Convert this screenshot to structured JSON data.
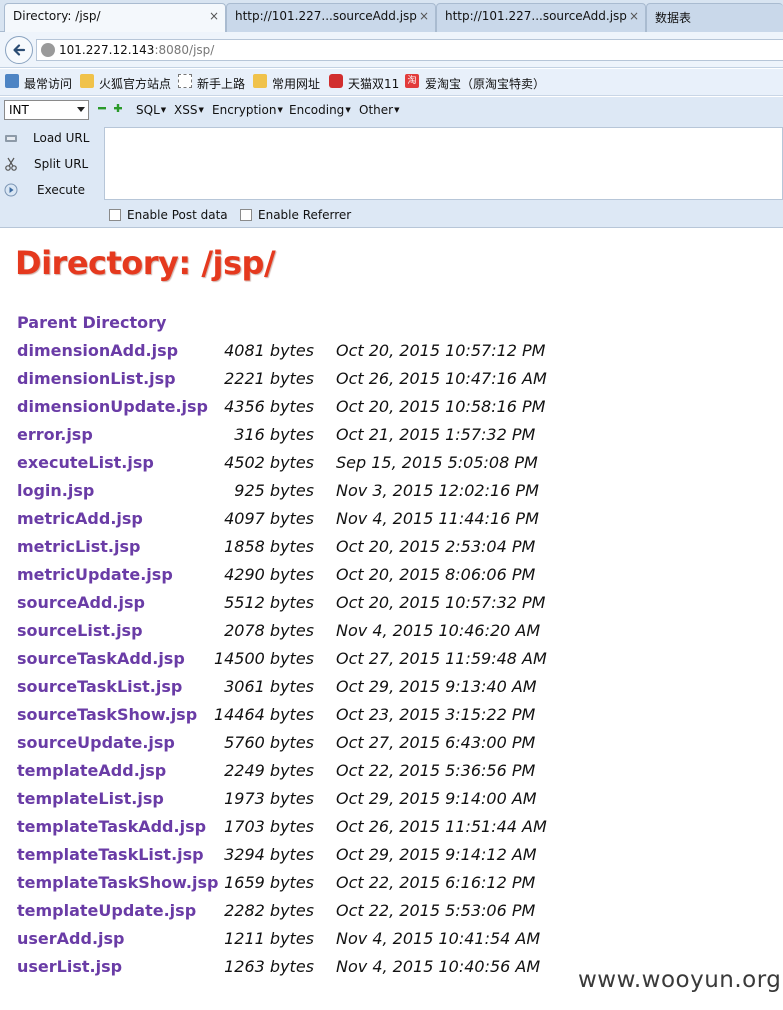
{
  "tabs": [
    {
      "label": "Directory: /jsp/",
      "close": "×"
    },
    {
      "label": "http://101.227...sourceAdd.jsp",
      "close": "×"
    },
    {
      "label": "http://101.227...sourceAdd.jsp",
      "close": "×"
    },
    {
      "label": "数据表",
      "close": ""
    }
  ],
  "address": {
    "host": "101.227.12.143",
    "rest": ":8080/jsp/"
  },
  "bookmarks": [
    "最常访问",
    "火狐官方站点",
    "新手上路",
    "常用网址",
    "天猫双11",
    "爱淘宝（原淘宝特卖）"
  ],
  "hackbar": {
    "select_value": "INT",
    "menus": [
      "SQL",
      "XSS",
      "Encryption",
      "Encoding",
      "Other"
    ],
    "actions": [
      "Load URL",
      "Split URL",
      "Execute"
    ],
    "checks": [
      "Enable Post data",
      "Enable Referrer"
    ],
    "colors": {
      "plus": "#2a9a2a",
      "minus": "#2a9a2a"
    }
  },
  "page": {
    "title": "Directory: /jsp/",
    "parent_link": "Parent Directory",
    "title_color": "#e5391e",
    "link_color": "#6a3ca6",
    "files": [
      {
        "name": "dimensionAdd.jsp",
        "size": "4081 bytes",
        "date": "Oct 20, 2015 10:57:12 PM"
      },
      {
        "name": "dimensionList.jsp",
        "size": "2221 bytes",
        "date": "Oct 26, 2015 10:47:16 AM"
      },
      {
        "name": "dimensionUpdate.jsp",
        "size": "4356 bytes",
        "date": "Oct 20, 2015 10:58:16 PM"
      },
      {
        "name": "error.jsp",
        "size": "316 bytes",
        "date": "Oct 21, 2015 1:57:32 PM"
      },
      {
        "name": "executeList.jsp",
        "size": "4502 bytes",
        "date": "Sep 15, 2015 5:05:08 PM"
      },
      {
        "name": "login.jsp",
        "size": "925 bytes",
        "date": "Nov 3, 2015 12:02:16 PM"
      },
      {
        "name": "metricAdd.jsp",
        "size": "4097 bytes",
        "date": "Nov 4, 2015 11:44:16 PM"
      },
      {
        "name": "metricList.jsp",
        "size": "1858 bytes",
        "date": "Oct 20, 2015 2:53:04 PM"
      },
      {
        "name": "metricUpdate.jsp",
        "size": "4290 bytes",
        "date": "Oct 20, 2015 8:06:06 PM"
      },
      {
        "name": "sourceAdd.jsp",
        "size": "5512 bytes",
        "date": "Oct 20, 2015 10:57:32 PM"
      },
      {
        "name": "sourceList.jsp",
        "size": "2078 bytes",
        "date": "Nov 4, 2015 10:46:20 AM"
      },
      {
        "name": "sourceTaskAdd.jsp",
        "size": "14500 bytes",
        "date": "Oct 27, 2015 11:59:48 AM"
      },
      {
        "name": "sourceTaskList.jsp",
        "size": "3061 bytes",
        "date": "Oct 29, 2015 9:13:40 AM"
      },
      {
        "name": "sourceTaskShow.jsp",
        "size": "14464 bytes",
        "date": "Oct 23, 2015 3:15:22 PM"
      },
      {
        "name": "sourceUpdate.jsp",
        "size": "5760 bytes",
        "date": "Oct 27, 2015 6:43:00 PM"
      },
      {
        "name": "templateAdd.jsp",
        "size": "2249 bytes",
        "date": "Oct 22, 2015 5:36:56 PM"
      },
      {
        "name": "templateList.jsp",
        "size": "1973 bytes",
        "date": "Oct 29, 2015 9:14:00 AM"
      },
      {
        "name": "templateTaskAdd.jsp",
        "size": "1703 bytes",
        "date": "Oct 26, 2015 11:51:44 AM"
      },
      {
        "name": "templateTaskList.jsp",
        "size": "3294 bytes",
        "date": "Oct 29, 2015 9:14:12 AM"
      },
      {
        "name": "templateTaskShow.jsp",
        "size": "1659 bytes",
        "date": "Oct 22, 2015 6:16:12 PM"
      },
      {
        "name": "templateUpdate.jsp",
        "size": "2282 bytes",
        "date": "Oct 22, 2015 5:53:06 PM"
      },
      {
        "name": "userAdd.jsp",
        "size": "1211 bytes",
        "date": "Nov 4, 2015 10:41:54 AM"
      },
      {
        "name": "userList.jsp",
        "size": "1263 bytes",
        "date": "Nov 4, 2015 10:40:56 AM"
      }
    ]
  },
  "watermark": "www.wooyun.org"
}
